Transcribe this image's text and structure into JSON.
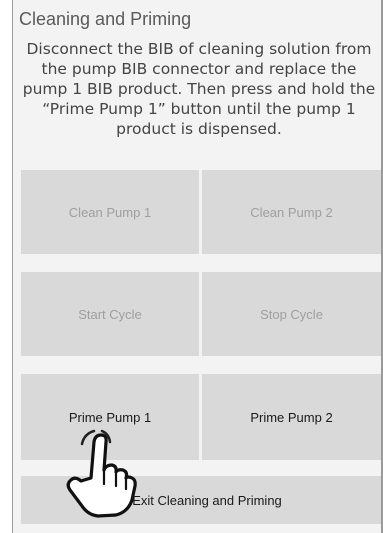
{
  "screen": {
    "title": "Cleaning and Priming",
    "instructions": "Disconnect the BIB of cleaning solution from the pump BIB connector and replace the pump 1 BIB product. Then press and hold the “Prime Pump 1” button until the pump 1 product is dispensed."
  },
  "buttons": {
    "clean_pump_1": {
      "label": "Clean Pump 1",
      "state": "disabled"
    },
    "clean_pump_2": {
      "label": "Clean Pump 2",
      "state": "disabled"
    },
    "start_cycle": {
      "label": "Start Cycle",
      "state": "disabled"
    },
    "stop_cycle": {
      "label": "Stop Cycle",
      "state": "disabled"
    },
    "prime_pump_1": {
      "label": "Prime Pump 1",
      "state": "enabled"
    },
    "prime_pump_2": {
      "label": "Prime Pump 2",
      "state": "enabled"
    },
    "exit": {
      "label": "Exit Cleaning and Priming",
      "state": "enabled"
    }
  },
  "overlay": {
    "icon": "pointing-hand-icon"
  },
  "colors": {
    "background": "#f3f3f3",
    "button": "#d9d9d9",
    "disabled_text": "#9e9e9e",
    "enabled_text": "#1a1a1a"
  }
}
